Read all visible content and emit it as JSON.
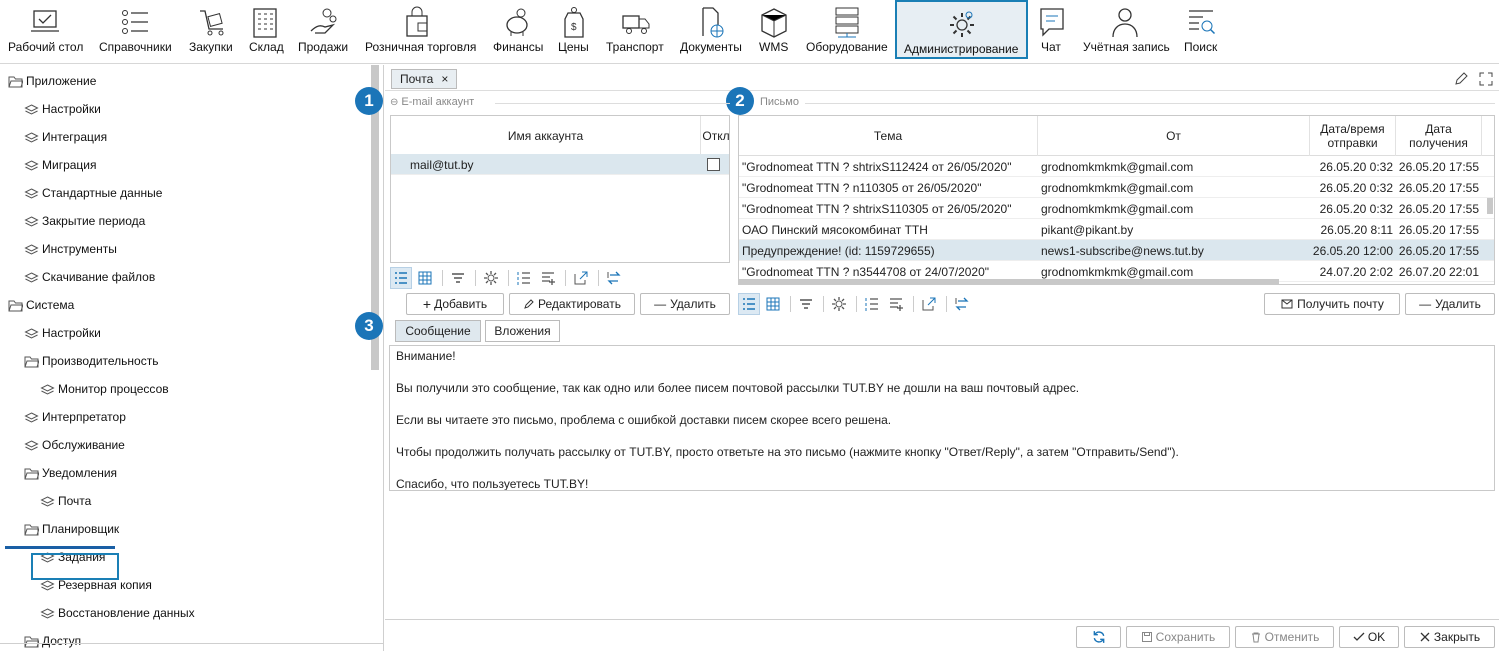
{
  "toolbar": {
    "items": [
      {
        "label": "Рабочий стол",
        "icon": "desktop-icon"
      },
      {
        "label": "Справочники",
        "icon": "list-icon"
      },
      {
        "label": "Закупки",
        "icon": "cart-icon"
      },
      {
        "label": "Склад",
        "icon": "warehouse-icon"
      },
      {
        "label": "Продажи",
        "icon": "hand-coins-icon"
      },
      {
        "label": "Розничная торговля",
        "icon": "shopping-bag-icon"
      },
      {
        "label": "Финансы",
        "icon": "piggy-bank-icon"
      },
      {
        "label": "Цены",
        "icon": "price-tag-icon"
      },
      {
        "label": "Транспорт",
        "icon": "truck-icon"
      },
      {
        "label": "Документы",
        "icon": "document-globe-icon"
      },
      {
        "label": "WMS",
        "icon": "box-icon"
      },
      {
        "label": "Оборудование",
        "icon": "server-icon"
      },
      {
        "label": "Администрирование",
        "icon": "gear-icon"
      },
      {
        "label": "Чат",
        "icon": "chat-icon"
      },
      {
        "label": "Учётная запись",
        "icon": "user-icon"
      },
      {
        "label": "Поиск",
        "icon": "search-list-icon"
      }
    ]
  },
  "tree": [
    {
      "label": "Приложение",
      "type": "folder"
    },
    {
      "label": "Настройки",
      "type": "node"
    },
    {
      "label": "Интеграция",
      "type": "node"
    },
    {
      "label": "Миграция",
      "type": "node"
    },
    {
      "label": "Стандартные данные",
      "type": "node"
    },
    {
      "label": "Закрытие периода",
      "type": "node"
    },
    {
      "label": "Инструменты",
      "type": "node"
    },
    {
      "label": "Скачивание файлов",
      "type": "node"
    },
    {
      "label": "Система",
      "type": "folder"
    },
    {
      "label": "Настройки",
      "type": "node"
    },
    {
      "label": "Производительность",
      "type": "folder"
    },
    {
      "label": "Монитор процессов",
      "type": "node"
    },
    {
      "label": "Интерпретатор",
      "type": "node"
    },
    {
      "label": "Обслуживание",
      "type": "node"
    },
    {
      "label": "Уведомления",
      "type": "folder"
    },
    {
      "label": "Почта",
      "type": "node"
    },
    {
      "label": "Планировщик",
      "type": "folder"
    },
    {
      "label": "Задания",
      "type": "node"
    },
    {
      "label": "Резервная копия",
      "type": "node"
    },
    {
      "label": "Восстановление данных",
      "type": "node"
    },
    {
      "label": "Доступ",
      "type": "folder"
    }
  ],
  "tab": {
    "label": "Почта",
    "close": "×"
  },
  "badges": [
    "1",
    "2",
    "3"
  ],
  "account": {
    "title": "E-mail аккаунт",
    "columns": [
      "Имя аккаунта",
      "Откл"
    ],
    "rows": [
      {
        "name": "mail@tut.by",
        "disabled": false
      }
    ],
    "buttons": {
      "add": "Добавить",
      "edit": "Редактировать",
      "delete": "Удалить"
    }
  },
  "letters": {
    "title": "Письмо",
    "columns": [
      "Тема",
      "От",
      "Дата/время отправки",
      "Дата получения"
    ],
    "rows": [
      [
        "\"Grodnomeat  TTN ?  shtrixS112424 от 26/05/2020\"",
        "grodnomkmkmk@gmail.com",
        "26.05.20 0:32",
        "26.05.20 17:55"
      ],
      [
        "\"Grodnomeat  TTN ? n110305 от 26/05/2020\"",
        "grodnomkmkmk@gmail.com",
        "26.05.20 0:32",
        "26.05.20 17:55"
      ],
      [
        "\"Grodnomeat  TTN ?  shtrixS110305 от 26/05/2020\"",
        "grodnomkmkmk@gmail.com",
        "26.05.20 0:32",
        "26.05.20 17:55"
      ],
      [
        "ОАО Пинский мясокомбинат ТТН",
        "pikant@pikant.by",
        "26.05.20 8:11",
        "26.05.20 17:55"
      ],
      [
        "Предупреждение! (id: 1159729655)",
        "news1-subscribe@news.tut.by",
        "26.05.20 12:00",
        "26.05.20 17:55"
      ],
      [
        "\"Grodnomeat  TTN ? n3544708 от 24/07/2020\"",
        "grodnomkmkmk@gmail.com",
        "24.07.20 2:02",
        "26.07.20 22:01"
      ]
    ],
    "buttons": {
      "receive": "Получить почту",
      "delete": "Удалить"
    }
  },
  "message_tabs": [
    "Сообщение",
    "Вложения"
  ],
  "message": [
    "Внимание!",
    "Вы получили это сообщение, так как одно или более писем почтовой рассылки TUT.BY не дошли на ваш почтовый адрес.",
    "Если вы читаете это письмо, проблема с ошибкой доставки писем скорее всего решена.",
    "Чтобы продолжить получать рассылку от TUT.BY, просто ответьте на это письмо (нажмите кнопку \"Ответ/Reply\", а затем \"Отправить/Send\").",
    "Спасибо, что пользуетесь TUT.BY!"
  ],
  "bottom": {
    "save": "Сохранить",
    "cancel": "Отменить",
    "ok": "OK",
    "close": "Закрыть"
  },
  "colors": {
    "accent": "#1b75b8",
    "selected_row": "#dbe7ee",
    "active_toolbar": "#e7eef3"
  }
}
